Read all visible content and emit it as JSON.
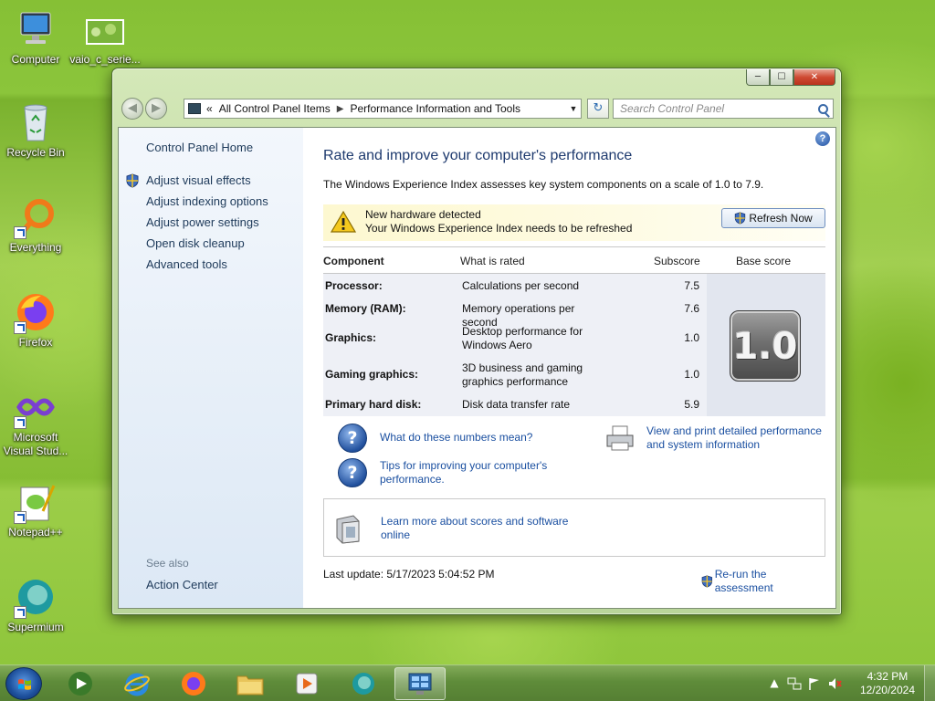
{
  "desktop": {
    "icons": [
      {
        "label": "Computer"
      },
      {
        "label": "vaio_c_serie..."
      },
      {
        "label": "Recycle Bin"
      },
      {
        "label": "Everything"
      },
      {
        "label": "Firefox"
      },
      {
        "label": "Microsoft Visual Stud..."
      },
      {
        "label": "Notepad++"
      },
      {
        "label": "Supermium"
      }
    ]
  },
  "window": {
    "caption": {
      "minimize": "─",
      "maximize": "☐",
      "close": "✕"
    },
    "address": {
      "prefix": "«",
      "crumbs": [
        "All Control Panel Items",
        "Performance Information and Tools"
      ]
    },
    "search_placeholder": "Search Control Panel"
  },
  "sidebar": {
    "home": "Control Panel Home",
    "links": [
      {
        "label": "Adjust visual effects",
        "shield": true
      },
      {
        "label": "Adjust indexing options",
        "shield": false
      },
      {
        "label": "Adjust power settings",
        "shield": false
      },
      {
        "label": "Open disk cleanup",
        "shield": false
      },
      {
        "label": "Advanced tools",
        "shield": false
      }
    ],
    "see_also": "See also",
    "action_center": "Action Center"
  },
  "content": {
    "title": "Rate and improve your computer's performance",
    "intro": "The Windows Experience Index assesses key system components on a scale of 1.0 to 7.9.",
    "notice": {
      "line1": "New hardware detected",
      "line2": "Your Windows Experience Index needs to be refreshed",
      "button": "Refresh Now"
    },
    "table": {
      "headers": {
        "component": "Component",
        "what": "What is rated",
        "subscore": "Subscore",
        "base": "Base score"
      },
      "rows": [
        {
          "component": "Processor:",
          "what": "Calculations per second",
          "subscore": "7.5"
        },
        {
          "component": "Memory (RAM):",
          "what": "Memory operations per second",
          "subscore": "7.6"
        },
        {
          "component": "Graphics:",
          "what": "Desktop performance for Windows Aero",
          "subscore": "1.0"
        },
        {
          "component": "Gaming graphics:",
          "what": "3D business and gaming graphics performance",
          "subscore": "1.0"
        },
        {
          "component": "Primary hard disk:",
          "what": "Disk data transfer rate",
          "subscore": "5.9"
        }
      ],
      "base_score": "1.0"
    },
    "links": {
      "numbers": "What do these numbers mean?",
      "tips": "Tips for improving your computer's performance.",
      "print": "View and print detailed performance and system information",
      "learn": "Learn more about scores and software online"
    },
    "last_update": "Last update: 5/17/2023 5:04:52 PM",
    "rerun": "Re-run the assessment"
  },
  "taskbar": {
    "clock_time": "4:32 PM",
    "clock_date": "12/20/2024"
  },
  "colors": {
    "accent_link": "#1a4fa0",
    "heading": "#1e3a6e",
    "notice_bg": "#fdf8d0",
    "wallpaper": "#8cc43a"
  }
}
